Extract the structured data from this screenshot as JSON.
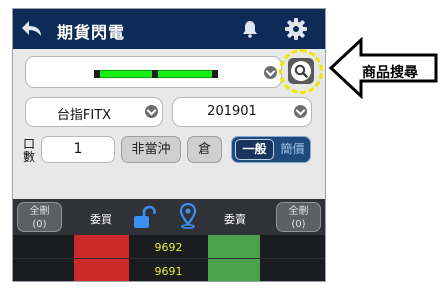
{
  "app": {
    "title": "期貨閃電"
  },
  "product": {
    "selected": ""
  },
  "contract": {
    "selected": "台指FITX"
  },
  "month": {
    "selected": "201901"
  },
  "order": {
    "qty_label": "口數",
    "qty_value": "1",
    "offset_button": "非當沖",
    "position_button": "倉",
    "mode_selected": "一般",
    "mode_other": "簡價"
  },
  "columns": {
    "delete_left": [
      "全刪",
      "(0)"
    ],
    "buy_label": "委買",
    "sell_label": "委賣",
    "delete_right": [
      "全刪",
      "(0)"
    ]
  },
  "ladder": {
    "prices": [
      "9692",
      "9691"
    ]
  },
  "annotation": {
    "label": "商品搜尋"
  },
  "colors": {
    "buy_column": "#cc2a2a",
    "sell_column": "#4ba24b",
    "highlight_ring": "#f2e600",
    "nav_bar": "#0e2a56"
  },
  "icons": [
    "back-arrow-icon",
    "bell-icon",
    "gear-icon",
    "search-icon",
    "unlock-icon",
    "location-pin-icon",
    "chevron-down-icon",
    "left-arrow-callout-icon"
  ]
}
